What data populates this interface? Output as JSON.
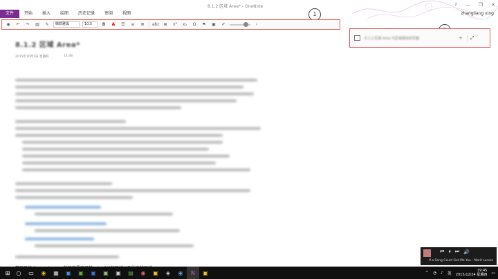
{
  "window": {
    "title": "8.1.2 区域 Area* - OneNote",
    "user": "zhangliang xing",
    "controls": [
      "?",
      "—",
      "❐",
      "✕"
    ]
  },
  "ribbon": {
    "file_tab": "文件",
    "tabs": [
      "开始",
      "插入",
      "绘图",
      "历史记录",
      "审阅",
      "视图"
    ]
  },
  "toolbar": {
    "font_name": "微软雅黑",
    "font_size": "10.5",
    "bold": "B",
    "underline": "A",
    "superscript": "x²",
    "subscript": "x₂",
    "special_char": "Ω"
  },
  "page": {
    "title": "8.1.2 区域 Area*",
    "date": "2015年10月1日 星期四",
    "time": "14:48",
    "visible_text": "整天工作  Sunny Area  ...  的区首是不只前，ArcGIS的区域以及所有的区域"
  },
  "callouts": {
    "one": "1",
    "two": "2"
  },
  "page_panel": {
    "placeholder_text": "8.1.2 区域 Area  与区域相关的页面",
    "plus": "+",
    "expand": "⤢"
  },
  "media": {
    "title": "If a Song Could Get Me You - Marit Larsen",
    "prev": "⏮",
    "play": "⏸",
    "next": "⏭"
  },
  "taskbar": {
    "start": "⊞",
    "time": "19:45",
    "date": "2015/12/24 星期四",
    "lang": "英"
  }
}
